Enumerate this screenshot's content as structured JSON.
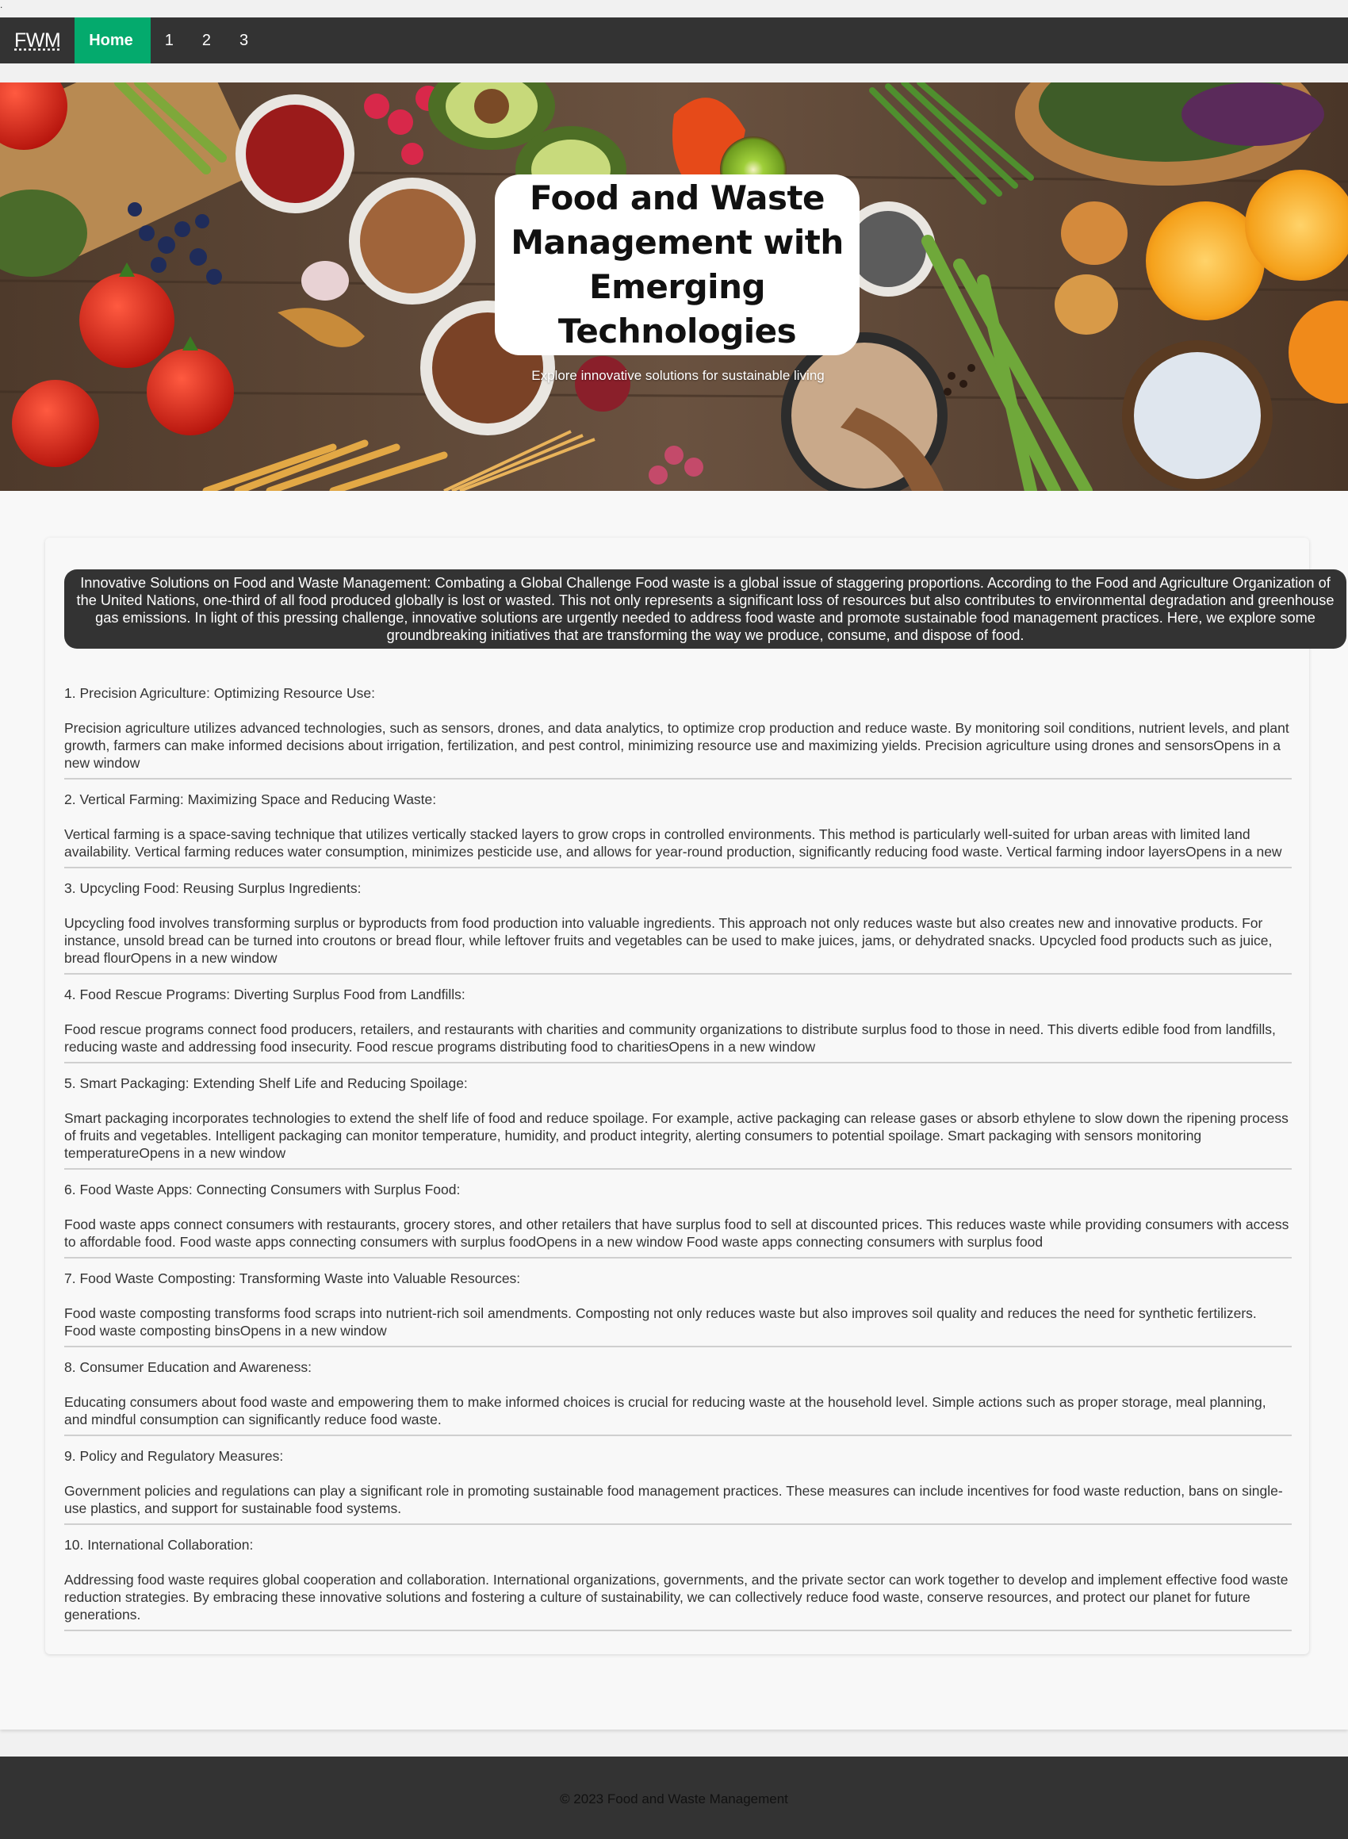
{
  "nav": {
    "brand": "FWM",
    "links": [
      {
        "label": "Home",
        "active": true
      },
      {
        "label": "1"
      },
      {
        "label": "2"
      },
      {
        "label": "3"
      }
    ],
    "accent": "#04aa6d",
    "bg": "#333333"
  },
  "hero": {
    "title": "Food and Waste Management with Emerging Technologies",
    "subtitle": "Explore innovative solutions for sustainable living"
  },
  "intro": "Innovative Solutions on Food and Waste Management: Combating a Global Challenge Food waste is a global issue of staggering proportions. According to the Food and Agriculture Organization of the United Nations, one-third of all food produced globally is lost or wasted. This not only represents a significant loss of resources but also contributes to environmental degradation and greenhouse gas emissions. In light of this pressing challenge, innovative solutions are urgently needed to address food waste and promote sustainable food management practices. Here, we explore some groundbreaking initiatives that are transforming the way we produce, consume, and dispose of food.",
  "sections": [
    {
      "heading": "1. Precision Agriculture: Optimizing Resource Use:",
      "body": "Precision agriculture utilizes advanced technologies, such as sensors, drones, and data analytics, to optimize crop production and reduce waste. By monitoring soil conditions, nutrient levels, and plant growth, farmers can make informed decisions about irrigation, fertilization, and pest control, minimizing resource use and maximizing yields. Precision agriculture using drones and sensorsOpens in a new window"
    },
    {
      "heading": "2. Vertical Farming: Maximizing Space and Reducing Waste:",
      "body": "Vertical farming is a space-saving technique that utilizes vertically stacked layers to grow crops in controlled environments. This method is particularly well-suited for urban areas with limited land availability. Vertical farming reduces water consumption, minimizes pesticide use, and allows for year-round production, significantly reducing food waste. Vertical farming indoor layersOpens in a new"
    },
    {
      "heading": "3. Upcycling Food: Reusing Surplus Ingredients:",
      "body": "Upcycling food involves transforming surplus or byproducts from food production into valuable ingredients. This approach not only reduces waste but also creates new and innovative products. For instance, unsold bread can be turned into croutons or bread flour, while leftover fruits and vegetables can be used to make juices, jams, or dehydrated snacks. Upcycled food products such as juice, bread flourOpens in a new window"
    },
    {
      "heading": "4. Food Rescue Programs: Diverting Surplus Food from Landfills:",
      "body": "Food rescue programs connect food producers, retailers, and restaurants with charities and community organizations to distribute surplus food to those in need. This diverts edible food from landfills, reducing waste and addressing food insecurity. Food rescue programs distributing food to charitiesOpens in a new window"
    },
    {
      "heading": "5. Smart Packaging: Extending Shelf Life and Reducing Spoilage:",
      "body": "Smart packaging incorporates technologies to extend the shelf life of food and reduce spoilage. For example, active packaging can release gases or absorb ethylene to slow down the ripening process of fruits and vegetables. Intelligent packaging can monitor temperature, humidity, and product integrity, alerting consumers to potential spoilage. Smart packaging with sensors monitoring temperatureOpens in a new window"
    },
    {
      "heading": "6. Food Waste Apps: Connecting Consumers with Surplus Food:",
      "body": "Food waste apps connect consumers with restaurants, grocery stores, and other retailers that have surplus food to sell at discounted prices. This reduces waste while providing consumers with access to affordable food. Food waste apps connecting consumers with surplus foodOpens in a new window Food waste apps connecting consumers with surplus food"
    },
    {
      "heading": "7. Food Waste Composting: Transforming Waste into Valuable Resources:",
      "body": "Food waste composting transforms food scraps into nutrient-rich soil amendments. Composting not only reduces waste but also improves soil quality and reduces the need for synthetic fertilizers. Food waste composting binsOpens in a new window"
    },
    {
      "heading": "8. Consumer Education and Awareness:",
      "body": "Educating consumers about food waste and empowering them to make informed choices is crucial for reducing waste at the household level. Simple actions such as proper storage, meal planning, and mindful consumption can significantly reduce food waste."
    },
    {
      "heading": "9. Policy and Regulatory Measures:",
      "body": "Government policies and regulations can play a significant role in promoting sustainable food management practices. These measures can include incentives for food waste reduction, bans on single-use plastics, and support for sustainable food systems."
    },
    {
      "heading": "10. International Collaboration:",
      "body": "Addressing food waste requires global cooperation and collaboration. International organizations, governments, and the private sector can work together to develop and implement effective food waste reduction strategies. By embracing these innovative solutions and fostering a culture of sustainability, we can collectively reduce food waste, conserve resources, and protect our planet for future generations."
    }
  ],
  "footer": "© 2023 Food and Waste Management"
}
